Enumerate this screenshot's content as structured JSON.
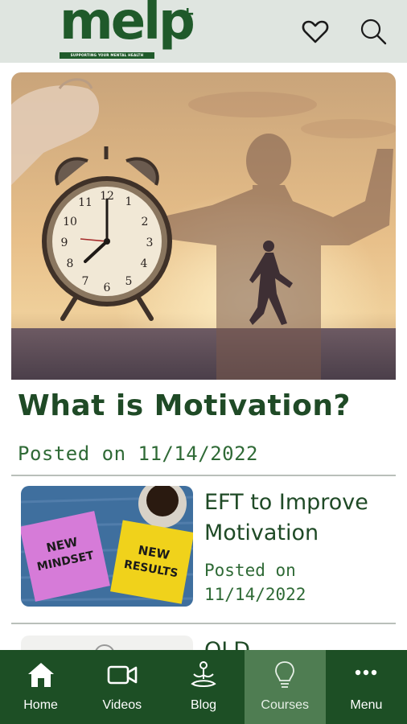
{
  "header": {
    "logo_text": "melp",
    "logo_plus": "+",
    "logo_tagline": "SUPPORTING YOUR MENTAL HEALTH",
    "icons": [
      "heart-icon",
      "search-icon"
    ]
  },
  "feature": {
    "title": "What is Motivation?",
    "date": "Posted on 11/14/2022",
    "image": "alarm clock and silhouette of strong runner at sunset"
  },
  "posts": [
    {
      "title": "EFT to Improve Motivation",
      "date": "Posted on 11/14/2022",
      "thumb_notes": [
        "NEW MINDSET",
        "NEW RESULTS"
      ]
    },
    {
      "title": "OLD"
    }
  ],
  "nav": {
    "items": [
      {
        "label": "Home",
        "icon": "home-icon"
      },
      {
        "label": "Videos",
        "icon": "video-icon"
      },
      {
        "label": "Blog",
        "icon": "meditation-icon"
      },
      {
        "label": "Courses",
        "icon": "lightbulb-icon",
        "active": true
      },
      {
        "label": "Menu",
        "icon": "more-icon"
      }
    ]
  },
  "colors": {
    "brand_green": "#1f5a2a",
    "nav_bg": "#1d4f25",
    "nav_active": "#4f7d52",
    "header_bg": "#dfe5e0"
  }
}
